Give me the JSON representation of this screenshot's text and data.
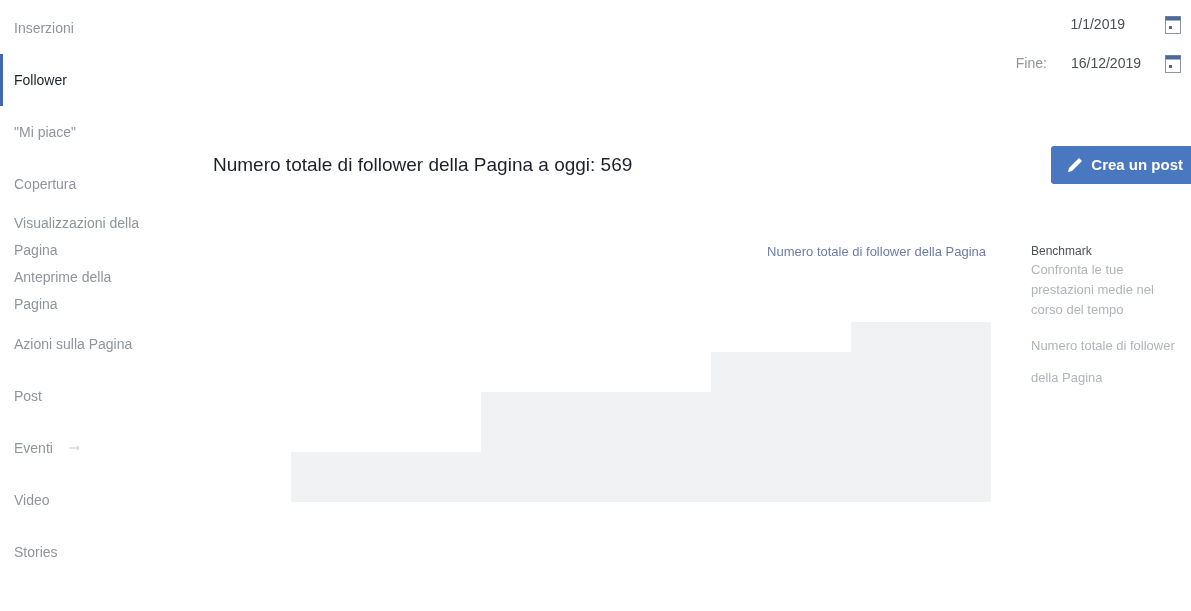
{
  "sidebar": {
    "items": [
      {
        "label": "Inserzioni",
        "selected": false
      },
      {
        "label": "Follower",
        "selected": true
      },
      {
        "label": "\"Mi piace\"",
        "selected": false
      },
      {
        "label": "Copertura",
        "selected": false
      },
      {
        "label": "Visualizzazioni della Pagina",
        "selected": false
      },
      {
        "label": "Anteprime della Pagina",
        "selected": false
      },
      {
        "label": "Azioni sulla Pagina",
        "selected": false
      },
      {
        "label": "Post",
        "selected": false
      },
      {
        "label": "Eventi",
        "selected": false,
        "arrow": true
      },
      {
        "label": "Video",
        "selected": false
      },
      {
        "label": "Stories",
        "selected": false
      }
    ]
  },
  "date_range": {
    "start": {
      "value": "1/1/2019"
    },
    "end": {
      "label": "Fine:",
      "value": "16/12/2019"
    }
  },
  "heading": "Numero totale di follower della Pagina a oggi: 569",
  "create_post_button": "Crea un post",
  "chart": {
    "legend": "Numero totale di follower della Pagina"
  },
  "benchmark": {
    "title": "Benchmark",
    "description": "Confronta le tue prestazioni medie nel corso del tempo",
    "metric": "Numero totale di follower della Pagina"
  }
}
